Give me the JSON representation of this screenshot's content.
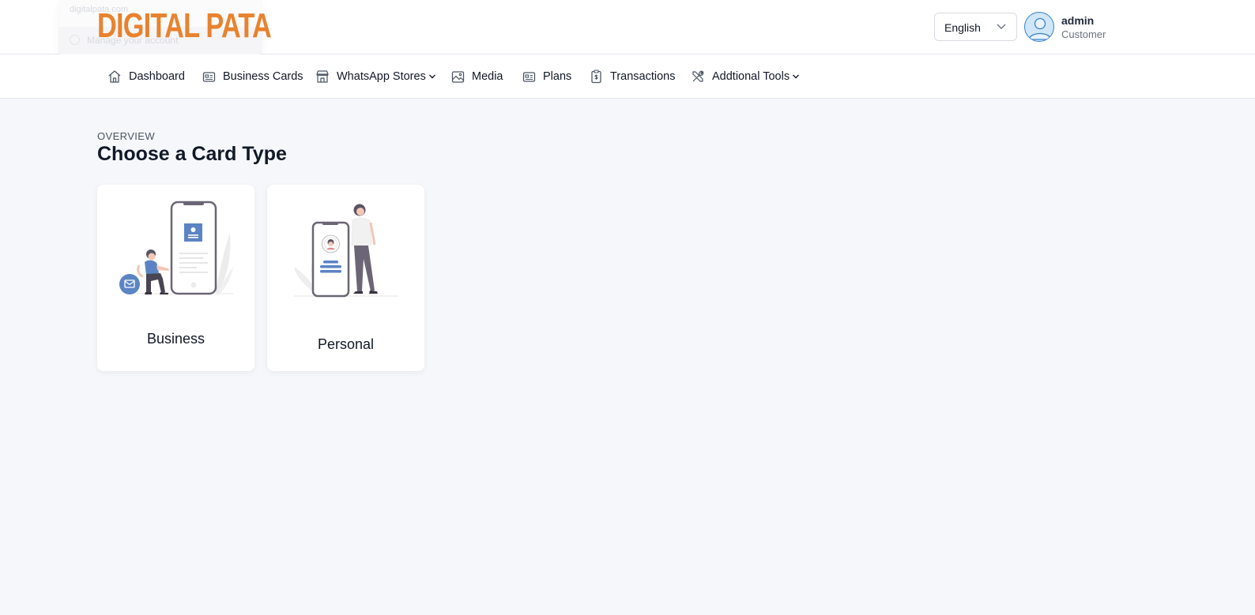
{
  "header": {
    "logo_text": "DIGITAL PATA",
    "ghost_menu": {
      "line1": "digitalpata.com",
      "line2": "Manage your account"
    },
    "language": {
      "selected": "English"
    },
    "user": {
      "name": "admin",
      "role": "Customer"
    }
  },
  "nav": {
    "items": [
      {
        "label": "Dashboard",
        "icon": "home-icon",
        "has_dropdown": false
      },
      {
        "label": "Business Cards",
        "icon": "id-card-icon",
        "has_dropdown": false
      },
      {
        "label": "WhatsApp Stores",
        "icon": "store-icon",
        "has_dropdown": true
      },
      {
        "label": "Media",
        "icon": "image-icon",
        "has_dropdown": false
      },
      {
        "label": "Plans",
        "icon": "id-card-icon",
        "has_dropdown": false
      },
      {
        "label": "Transactions",
        "icon": "receipt-icon",
        "has_dropdown": false
      },
      {
        "label": "Addtional Tools",
        "icon": "tools-icon",
        "has_dropdown": true
      }
    ]
  },
  "main": {
    "overline": "OVERVIEW",
    "title": "Choose a Card Type",
    "cards": [
      {
        "label": "Business",
        "illustration": "business-card-illustration"
      },
      {
        "label": "Personal",
        "illustration": "personal-card-illustration"
      }
    ]
  },
  "colors": {
    "brand": "#e8822e",
    "accent_blue": "#5b84c4",
    "page_bg": "#f5f7fb",
    "text": "#111827"
  }
}
